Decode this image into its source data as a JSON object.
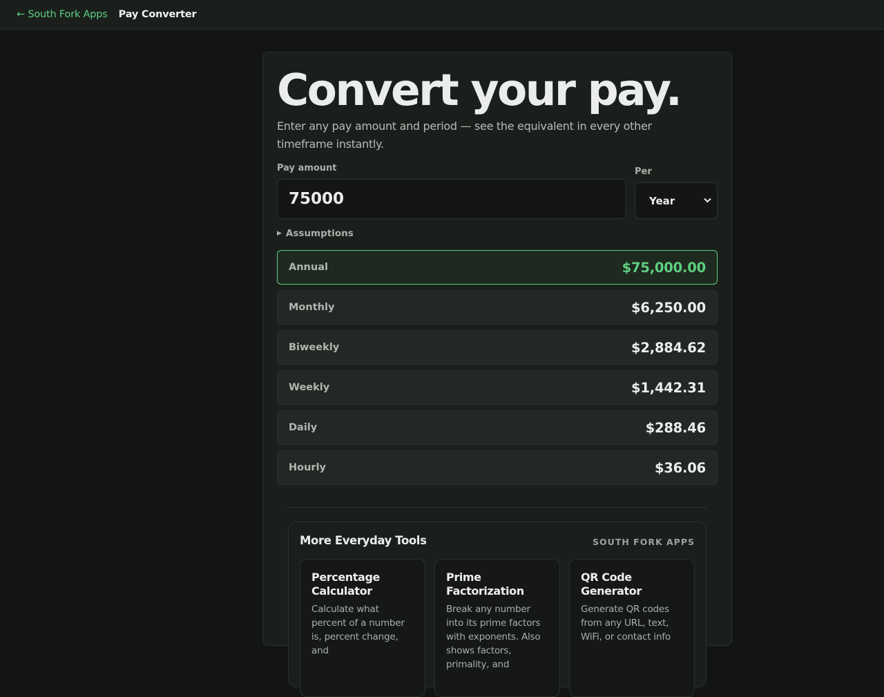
{
  "nav": {
    "back_label": "← South Fork Apps",
    "page_title": "Pay Converter"
  },
  "hero": {
    "title": "Convert your pay.",
    "subtitle": "Enter any pay amount and period — see the equivalent in every other timeframe instantly."
  },
  "form": {
    "amount_label": "Pay amount",
    "amount_value": "75000",
    "per_label": "Per",
    "per_value": "Year",
    "assumptions_label": "Assumptions"
  },
  "results": [
    {
      "label": "Annual",
      "value": "$75,000.00",
      "active": true
    },
    {
      "label": "Monthly",
      "value": "$6,250.00",
      "active": false
    },
    {
      "label": "Biweekly",
      "value": "$2,884.62",
      "active": false
    },
    {
      "label": "Weekly",
      "value": "$1,442.31",
      "active": false
    },
    {
      "label": "Daily",
      "value": "$288.46",
      "active": false
    },
    {
      "label": "Hourly",
      "value": "$36.06",
      "active": false
    }
  ],
  "tools": {
    "title": "More Everyday Tools",
    "brand": "SOUTH FORK APPS",
    "items": [
      {
        "name": "Percentage Calculator",
        "desc": "Calculate what percent of a number is, percent change, and"
      },
      {
        "name": "Prime Factorization",
        "desc": "Break any number into its prime factors with exponents. Also shows factors, primality, and"
      },
      {
        "name": "QR Code Generator",
        "desc": "Generate QR codes from any URL, text, WiFi, or contact info"
      }
    ]
  },
  "colors": {
    "accent": "#5fcf80",
    "background": "#121513",
    "card": "#1b1f1c"
  }
}
